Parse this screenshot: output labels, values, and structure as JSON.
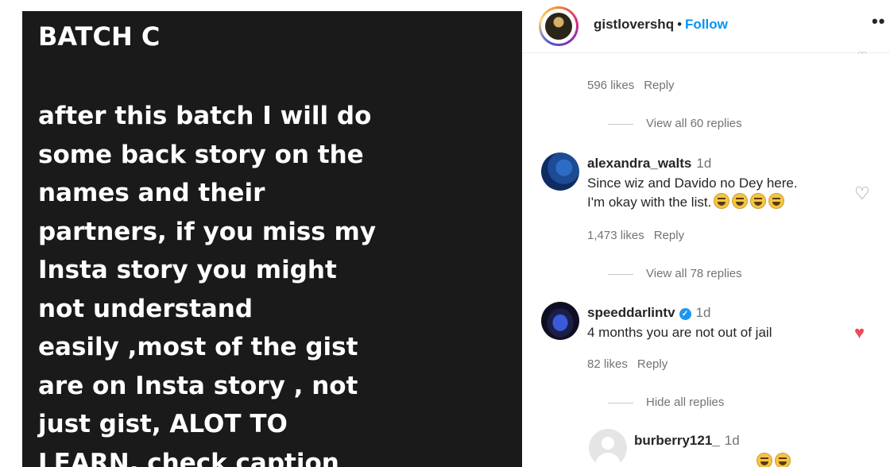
{
  "post": {
    "title": "BATCH C",
    "body": "after this batch I will do\nsome back story on the\nnames and their\npartners, if you miss my\nInsta story you might\nnot understand\neasily ,most of the gist\nare on Insta story , not\njust gist, ALOT TO\nLEARN, check caption"
  },
  "header": {
    "username": "gistlovershq",
    "separator": "•",
    "follow_label": "Follow",
    "more_label": "••"
  },
  "comments": [
    {
      "likes": "596 likes",
      "reply_label": "Reply",
      "view_replies": "View all 60 replies"
    },
    {
      "username": "alexandra_walts",
      "time": "1d",
      "text_line1": "Since wiz and Davido no Dey here.",
      "text_line2": "I'm okay with the list.",
      "emoji_count": 4,
      "likes": "1,473 likes",
      "reply_label": "Reply",
      "view_replies": "View all 78 replies",
      "liked": false
    },
    {
      "username": "speeddarlintv",
      "verified": true,
      "time": "1d",
      "text": "4 months you are not out of jail",
      "likes": "82 likes",
      "reply_label": "Reply",
      "view_replies": "Hide all replies",
      "liked": true
    },
    {
      "username": "burberry121_",
      "time": "1d"
    }
  ],
  "icons": {
    "heart_outline": "heart-icon",
    "heart_filled": "heart-filled-icon",
    "verified": "verified-badge-icon"
  },
  "colors": {
    "link_blue": "#0095f6",
    "like_red": "#ed4956",
    "post_bg": "#1b1a1a"
  }
}
